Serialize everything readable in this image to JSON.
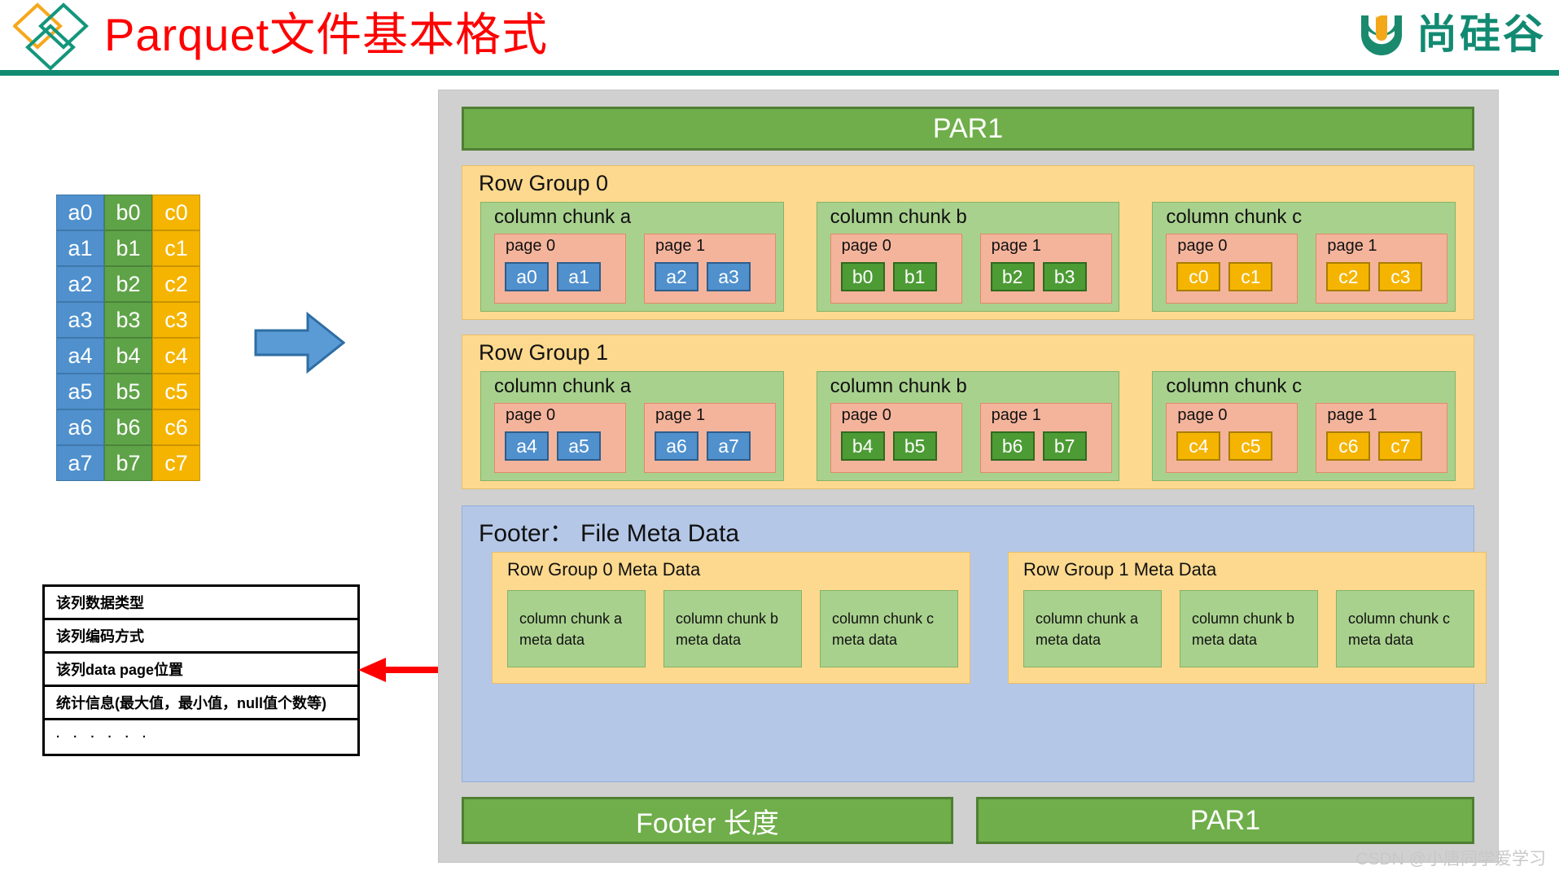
{
  "header": {
    "title": "Parquet文件基本格式",
    "brand_text": "尚硅谷",
    "logo_icon": "diamonds-icon",
    "brand_icon": "atguigu-u-icon",
    "title_color": "#ff0000",
    "brand_color": "#128a72"
  },
  "source_table": {
    "columns": [
      {
        "name": "a",
        "color": "#4F90CD",
        "cells": [
          "a0",
          "a1",
          "a2",
          "a3",
          "a4",
          "a5",
          "a6",
          "a7"
        ]
      },
      {
        "name": "b",
        "color": "#5FA348",
        "cells": [
          "b0",
          "b1",
          "b2",
          "b3",
          "b4",
          "b5",
          "b6",
          "b7"
        ]
      },
      {
        "name": "c",
        "color": "#F5B400",
        "cells": [
          "c0",
          "c1",
          "c2",
          "c3",
          "c4",
          "c5",
          "c6",
          "c7"
        ]
      }
    ]
  },
  "flow_arrow_icon": "right-arrow-icon",
  "red_arrow_icon": "left-arrow-icon",
  "meta_legend": {
    "rows": [
      "该列数据类型",
      "该列编码方式",
      "该列data page位置",
      "统计信息(最大值，最小值，null值个数等)",
      "· · · · · ·"
    ]
  },
  "parquet": {
    "magic_top": "PAR1",
    "footer_length_label": "Footer 长度",
    "magic_bottom": "PAR1",
    "colors": {
      "container": "#D0D0D0",
      "magic_bar": "#6FAE4A",
      "row_group": "#FCD98E",
      "column_chunk": "#A9D18E",
      "page": "#F4B49C",
      "footer": "#B4C7E7"
    },
    "row_groups": [
      {
        "title": "Row Group 0",
        "chunks": [
          {
            "title": "column chunk a",
            "value_class": "val-a",
            "pages": [
              {
                "title": "page 0",
                "values": [
                  "a0",
                  "a1"
                ]
              },
              {
                "title": "page 1",
                "values": [
                  "a2",
                  "a3"
                ]
              }
            ]
          },
          {
            "title": "column chunk b",
            "value_class": "val-b",
            "pages": [
              {
                "title": "page 0",
                "values": [
                  "b0",
                  "b1"
                ]
              },
              {
                "title": "page 1",
                "values": [
                  "b2",
                  "b3"
                ]
              }
            ]
          },
          {
            "title": "column chunk c",
            "value_class": "val-c",
            "pages": [
              {
                "title": "page 0",
                "values": [
                  "c0",
                  "c1"
                ]
              },
              {
                "title": "page 1",
                "values": [
                  "c2",
                  "c3"
                ]
              }
            ]
          }
        ]
      },
      {
        "title": "Row Group 1",
        "chunks": [
          {
            "title": "column chunk a",
            "value_class": "val-a",
            "pages": [
              {
                "title": "page 0",
                "values": [
                  "a4",
                  "a5"
                ]
              },
              {
                "title": "page 1",
                "values": [
                  "a6",
                  "a7"
                ]
              }
            ]
          },
          {
            "title": "column chunk b",
            "value_class": "val-b",
            "pages": [
              {
                "title": "page 0",
                "values": [
                  "b4",
                  "b5"
                ]
              },
              {
                "title": "page 1",
                "values": [
                  "b6",
                  "b7"
                ]
              }
            ]
          },
          {
            "title": "column chunk c",
            "value_class": "val-c",
            "pages": [
              {
                "title": "page 0",
                "values": [
                  "c4",
                  "c5"
                ]
              },
              {
                "title": "page 1",
                "values": [
                  "c6",
                  "c7"
                ]
              }
            ]
          }
        ]
      }
    ],
    "footer": {
      "title": "Footer： File Meta Data",
      "groups": [
        {
          "title": "Row Group 0 Meta Data",
          "chunk_meta": [
            "column chunk a\nmeta data",
            "column chunk b\nmeta data",
            "column chunk c\nmeta data"
          ]
        },
        {
          "title": "Row Group 1 Meta Data",
          "chunk_meta": [
            "column chunk a\nmeta data",
            "column chunk b\nmeta data",
            "column chunk c\nmeta data"
          ]
        }
      ]
    }
  },
  "watermark": "CSDN @小唐同学爱学习"
}
